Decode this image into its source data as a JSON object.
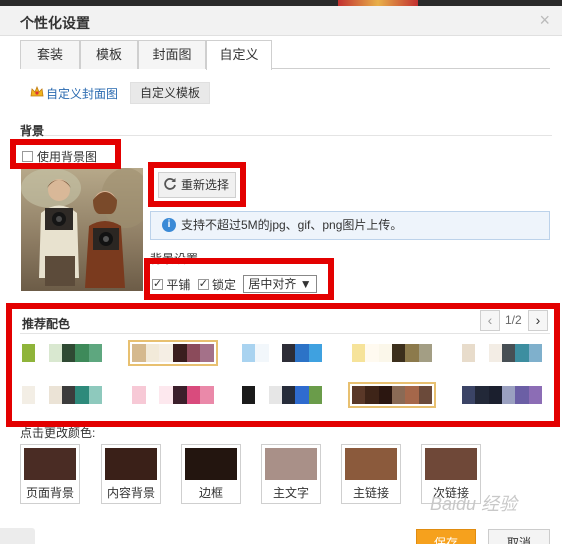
{
  "dialog": {
    "title": "个性化设置",
    "close_label": "×"
  },
  "tabs": [
    {
      "label": "套装"
    },
    {
      "label": "模板"
    },
    {
      "label": "封面图"
    },
    {
      "label": "自定义",
      "active": true
    }
  ],
  "subtabs": [
    {
      "label": "自定义封面图",
      "active": true
    },
    {
      "label": "自定义模板"
    }
  ],
  "background": {
    "section_title": "背景",
    "use_bg_label": "使用背景图",
    "use_bg_checked": false,
    "reselect_label": "重新选择",
    "info_text": "支持不超过5M的jpg、gif、png图片上传。",
    "settings_label": "背景设置",
    "tile_label": "平铺",
    "tile_checked": true,
    "lock_label": "锁定",
    "lock_checked": true,
    "align_value": "居中对齐 ▼"
  },
  "recommended": {
    "section_title": "推荐配色",
    "page_indicator": "1/2",
    "prev_label": "‹",
    "next_label": "›",
    "palettes": [
      {
        "colors": [
          "#8fb43a",
          "#ffffff",
          "#d9e8d0",
          "#2f4a33",
          "#3e8a5a",
          "#5ea77f"
        ]
      },
      {
        "colors": [
          "#d5b98e",
          "#f2ead9",
          "#f5eee4",
          "#3a1e1e",
          "#8b4b5b",
          "#a47189"
        ],
        "selected": true
      },
      {
        "colors": [
          "#a9d3f0",
          "#f2f7fb",
          "#ffffff",
          "#2d2d37",
          "#2c73c7",
          "#3fa1e0"
        ]
      },
      {
        "colors": [
          "#f6e39a",
          "#fffaf0",
          "#fbf7ea",
          "#3c2f1c",
          "#8c7a4c",
          "#a39e84"
        ]
      },
      {
        "colors": [
          "#e8dccb",
          "#ffffff",
          "#f3ede5",
          "#474f54",
          "#3d8ea0",
          "#7fb0cc"
        ]
      },
      {
        "colors": [
          "#f3eee5",
          "#ffffff",
          "#ebe3d6",
          "#3c3c3c",
          "#2e8a7b",
          "#8ec9bd"
        ]
      },
      {
        "colors": [
          "#f7c9d6",
          "#ffffff",
          "#fde8ee",
          "#3b1f2b",
          "#d94b7d",
          "#ea89a9"
        ]
      },
      {
        "colors": [
          "#1a1a1a",
          "#ffffff",
          "#e6e6e6",
          "#262c3a",
          "#2f6bcf",
          "#6a9c4a"
        ]
      },
      {
        "colors": [
          "#5a3828",
          "#3e2418",
          "#2b1610",
          "#8a6a55",
          "#a5674a",
          "#6b4a3a"
        ],
        "selected": true
      },
      {
        "colors": [
          "#3b4466",
          "#222838",
          "#1b1f2e",
          "#9aa0c0",
          "#6b5fa5",
          "#8c6db5"
        ]
      }
    ]
  },
  "custom_colors": {
    "label": "点击更改颜色:",
    "items": [
      {
        "label": "页面背景",
        "color": "#4a2c24"
      },
      {
        "label": "内容背景",
        "color": "#3a2018"
      },
      {
        "label": "边框",
        "color": "#23150f"
      },
      {
        "label": "主文字",
        "color": "#a99088"
      },
      {
        "label": "主链接",
        "color": "#8b5a3c"
      },
      {
        "label": "次链接",
        "color": "#6f4838"
      }
    ]
  },
  "footer": {
    "save_label": "保存",
    "cancel_label": "取消"
  },
  "watermark": {
    "text": "Baidu 经验"
  }
}
